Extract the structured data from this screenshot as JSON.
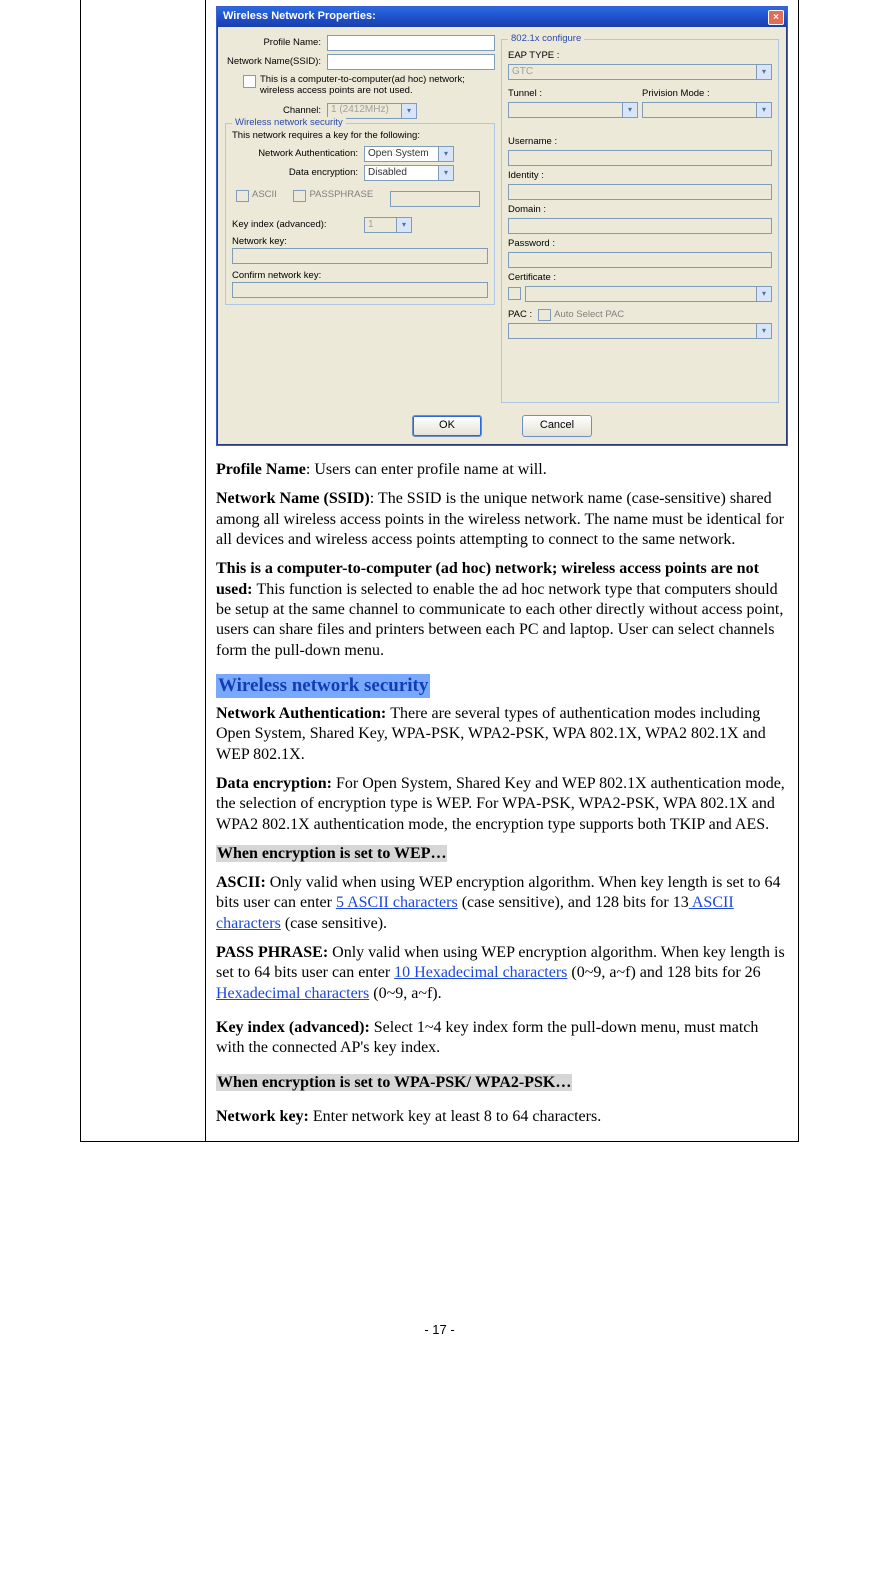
{
  "dialog": {
    "title": "Wireless Network Properties:",
    "close_label": "×",
    "left": {
      "profile_name_label": "Profile Name:",
      "ssid_label": "Network Name(SSID):",
      "adhoc_label": "This is a computer-to-computer(ad hoc) network; wireless access points are not used.",
      "channel_label": "Channel:",
      "channel_value": "1  (2412MHz)",
      "security_legend": "Wireless network security",
      "security_intro": "This network requires a key for the following:",
      "auth_label": "Network Authentication:",
      "auth_value": "Open System",
      "enc_label": "Data encryption:",
      "enc_value": "Disabled",
      "ascii_label": "ASCII",
      "pass_label": "PASSPHRASE",
      "keyindex_label": "Key index (advanced):",
      "keyindex_value": "1",
      "netkey_label": "Network key:",
      "confirm_label": "Confirm network key:"
    },
    "right": {
      "legend": "802.1x configure",
      "eap_label": "EAP TYPE :",
      "eap_value": "GTC",
      "tunnel_label": "Tunnel :",
      "priv_label": "Privision Mode :",
      "user_label": "Username :",
      "identity_label": "Identity :",
      "domain_label": "Domain :",
      "password_label": "Password :",
      "cert_label": "Certificate :",
      "pac_label": "PAC :",
      "auto_pac_label": "Auto Select PAC"
    },
    "buttons": {
      "ok": "OK",
      "cancel": "Cancel"
    }
  },
  "doc": {
    "p1_b": "Profile Name",
    "p1": ": Users can enter profile name at will.",
    "p2_b": "Network Name (SSID)",
    "p2": ": The SSID is the unique network name (case-sensitive) shared among all wireless access points in the wireless network. The name must be identical for all devices and wireless access points attempting to connect to the same network.",
    "p3_b": "This is a computer-to-computer (ad hoc) network; wireless access points are not used: ",
    "p3": "This function is selected to enable the ad hoc network type that computers should be setup at the same channel to communicate to each other directly without access point, users can share files and printers between each PC and laptop. User can select channels form the pull-down menu.",
    "h1": "Wireless network security",
    "p4_b": "Network Authentication: ",
    "p4": "There are several types of authentication modes including Open System, Shared Key, WPA-PSK, WPA2-PSK, WPA 802.1X, WPA2 802.1X and WEP 802.1X.",
    "p5_b": "Data encryption: ",
    "p5": "For Open System, Shared Key and WEP 802.1X authentication mode, the selection of encryption type is WEP. For WPA-PSK, WPA2-PSK, WPA 802.1X and WPA2 802.1X authentication mode, the encryption type supports both TKIP and AES.",
    "h2": "When encryption is set to WEP…",
    "p6_b": "ASCII: ",
    "p6a": "Only valid when using WEP encryption algorithm. When key length is set to 64 bits user can enter ",
    "p6_l1": "5 ASCII characters",
    "p6b": " (case sensitive), and 128 bits for 13",
    "p6_l2": " ASCII characters",
    "p6c": " (case sensitive).",
    "p7_b": "PASS PHRASE: ",
    "p7a": "Only valid when using WEP encryption algorithm. When key length is set to 64 bits user can enter ",
    "p7_l1": "10 Hexadecimal characters",
    "p7b": " (0~9, a~f) and 128 bits for 26 ",
    "p7_l2": "Hexadecimal characters",
    "p7c": " (0~9, a~f).",
    "p8_b": "Key index (advanced): ",
    "p8": "Select 1~4 key index form the pull-down menu, must match with the connected AP's key index.",
    "h3": "When encryption is set to WPA-PSK/ WPA2-PSK…",
    "p9_b": "Network key: ",
    "p9": "Enter network key at least 8 to 64 characters."
  },
  "footer": "- 17 -"
}
